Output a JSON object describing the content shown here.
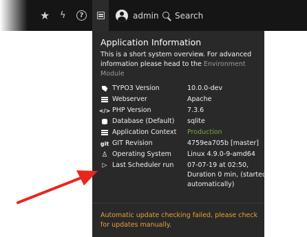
{
  "toolbar": {
    "icons": [
      "star-icon",
      "bolt-icon",
      "help-icon",
      "system-information-icon"
    ],
    "username": "admin",
    "search_label": "Search"
  },
  "panel": {
    "title": "Application Information",
    "description_prefix": "This is a short system overview. For advanced information please head to the ",
    "description_link": "Environment Module",
    "rows": [
      {
        "icon": "typo3-icon",
        "label": "TYPO3 Version",
        "value": "10.0.0-dev"
      },
      {
        "icon": "server-icon",
        "label": "Webserver",
        "value": "Apache"
      },
      {
        "icon": "code-icon",
        "label": "PHP Version",
        "value": "7.3.6"
      },
      {
        "icon": "database-icon",
        "label": "Database (Default)",
        "value": "sqlite"
      },
      {
        "icon": "context-icon",
        "label": "Application Context",
        "value": "Production"
      },
      {
        "icon": "git-icon",
        "label": "GIT Revision",
        "value": "4759ea705b [master]"
      },
      {
        "icon": "linux-icon",
        "label": "Operating System",
        "value": "Linux 4.9.0-9-amd64"
      },
      {
        "icon": "play-icon",
        "label": "Last Scheduler run",
        "value": "07-07-19 at 02:50, Duration 0 min, (started automatically)"
      }
    ],
    "warning": "Automatic update checking failed, please check for updates manually."
  },
  "colors": {
    "topbar": "#151515",
    "panel": "#292929",
    "production": "#79a548",
    "warning": "#e8a235",
    "arrow": "#e8261c"
  }
}
